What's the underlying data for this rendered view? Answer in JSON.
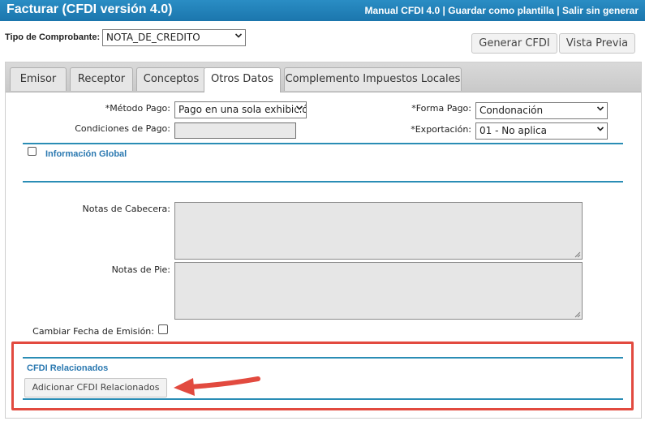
{
  "header": {
    "title": "Facturar (CFDI versión 4.0)",
    "link_manual": "Manual CFDI 4.0",
    "separator": " | ",
    "link_plantilla": "Guardar como plantilla",
    "link_salir": "Salir sin generar"
  },
  "tipo": {
    "label": "Tipo de Comprobante:",
    "value": "NOTA_DE_CREDITO"
  },
  "toolbar": {
    "generar": "Generar CFDI",
    "vista_previa": "Vista Previa"
  },
  "tabs": [
    {
      "label": "Emisor"
    },
    {
      "label": "Receptor"
    },
    {
      "label": "Conceptos"
    },
    {
      "label": "Otros Datos",
      "active": true
    },
    {
      "label": "Complemento Impuestos Locales"
    }
  ],
  "form": {
    "metodo_pago_label": "*Método Pago:",
    "metodo_pago_value": "Pago en una sola exhibición",
    "forma_pago_label": "*Forma Pago:",
    "forma_pago_value": "Condonación",
    "condiciones_label": "Condiciones de Pago:",
    "condiciones_value": "",
    "exportacion_label": "*Exportación:",
    "exportacion_value": "01 - No aplica",
    "info_global_label": "Información Global",
    "notas_cabecera_label": "Notas de Cabecera:",
    "notas_pie_label": "Notas de Pie:",
    "cambiar_fecha_label": "Cambiar Fecha de Emisión:"
  },
  "relacionados": {
    "title": "CFDI Relacionados",
    "button": "Adicionar CFDI Relacionados"
  },
  "colors": {
    "accent": "#1b76ad",
    "highlight": "#e24a3f",
    "section_title": "#2a78b0"
  }
}
